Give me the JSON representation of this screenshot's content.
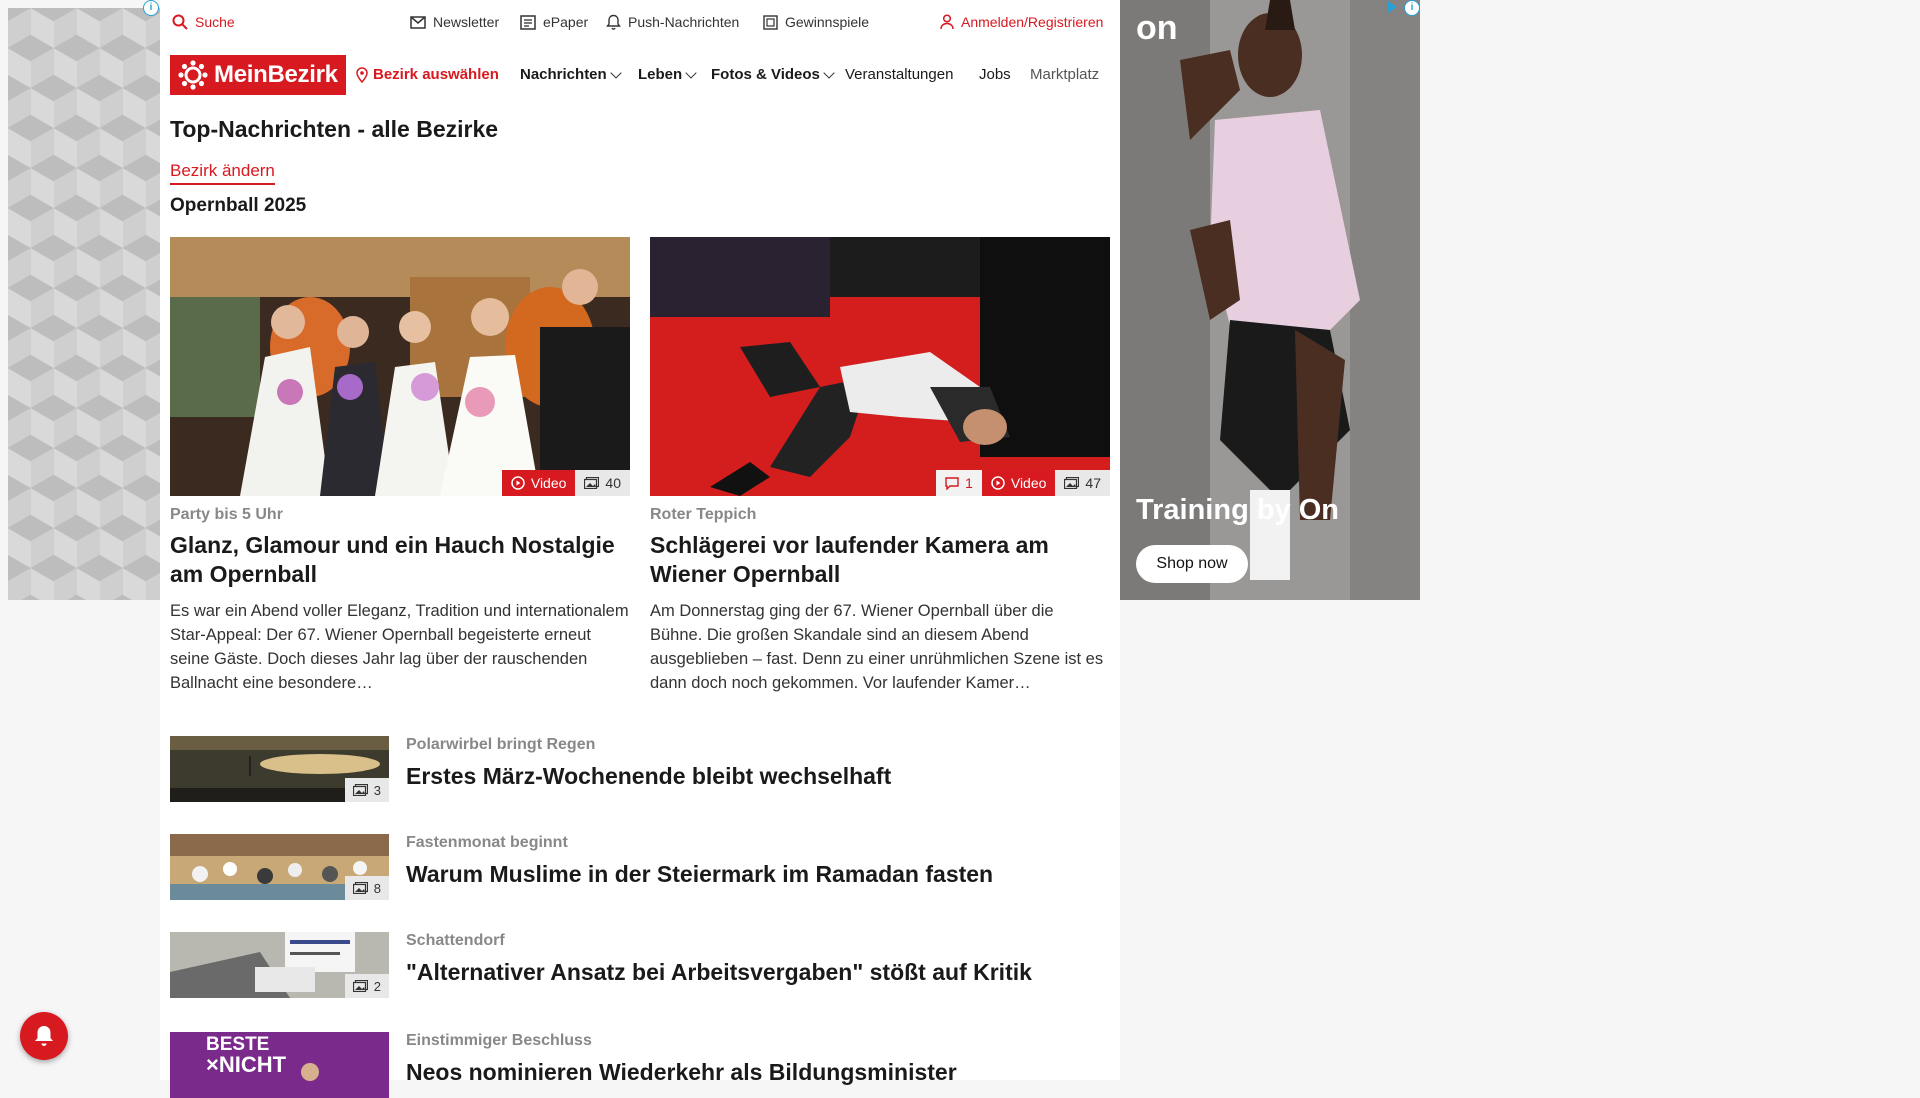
{
  "topbar": {
    "search": "Suche",
    "newsletter": "Newsletter",
    "epaper": "ePaper",
    "push": "Push-Nachrichten",
    "games": "Gewinnspiele",
    "login": "Anmelden/Registrieren"
  },
  "nav": {
    "logo": "MeinBezirk",
    "district": "Bezirk auswählen",
    "items": [
      "Nachrichten",
      "Leben",
      "Fotos & Videos",
      "Veranstaltungen",
      "Jobs",
      "Marktplatz"
    ]
  },
  "page": {
    "title": "Top-Nachrichten - alle Bezirke",
    "change_link": "Bezirk ändern",
    "topic": "Opernball 2025"
  },
  "featured": [
    {
      "kicker": "Party bis 5 Uhr",
      "title": "Glanz, Glamour und ein Hauch Nostalgie am Opernball",
      "teaser": "Es war ein Abend voller Eleganz, Tradition und internationalem Star-Appeal: Der 67. Wiener Opernball begeisterte erneut seine Gäste. Doch dieses Jahr lag über der rauschenden Ballnacht eine besondere…",
      "video_label": "Video",
      "photo_count": "40"
    },
    {
      "kicker": "Roter Teppich",
      "title": "Schlägerei vor laufender Kamera am Wiener Opernball",
      "teaser": "Am Donnerstag ging der 67. Wiener Opernball über die Bühne. Die großen Skandale sind an diesem Abend ausgeblieben – fast. Denn zu einer unrühmlichen Szene ist es dann doch noch gekommen. Vor laufender Kamer…",
      "comment_count": "1",
      "video_label": "Video",
      "photo_count": "47"
    }
  ],
  "articles": [
    {
      "kicker": "Polarwirbel bringt Regen",
      "title": "Erstes März-Wochenende bleibt wechselhaft",
      "photo_count": "3"
    },
    {
      "kicker": "Fastenmonat beginnt",
      "title": "Warum Muslime in der Steiermark im Ramadan fasten",
      "photo_count": "8"
    },
    {
      "kicker": "Schattendorf",
      "title": "\"Alternativer Ansatz bei Arbeitsvergaben\" stößt auf Kritik",
      "photo_count": "2"
    },
    {
      "kicker": "Einstimmiger Beschluss",
      "title": "Neos nominieren Wiederkehr als Bildungsminister",
      "photo_count": ""
    }
  ],
  "ad": {
    "headline": "Training by On",
    "button": "Shop now",
    "brand": "on"
  },
  "colors": {
    "brand_red": "#d71920",
    "kicker_grey": "#888888"
  },
  "icons": [
    "search-icon",
    "mail-icon",
    "newspaper-icon",
    "bell-icon",
    "gift-icon",
    "user-icon",
    "location-pin-icon",
    "play-icon",
    "image-icon",
    "comment-icon"
  ]
}
